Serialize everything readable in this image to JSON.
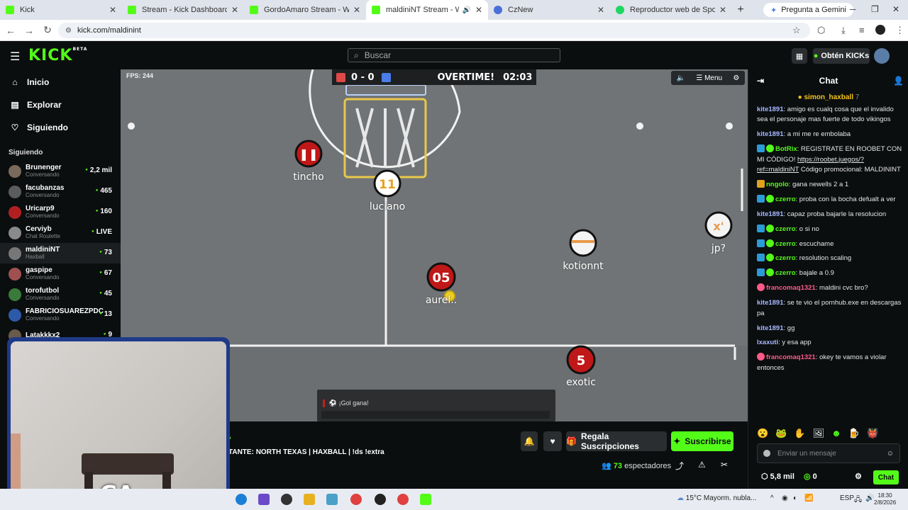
{
  "browser": {
    "tabs": [
      {
        "title": "Kick",
        "color": "#53fc18"
      },
      {
        "title": "Stream - Kick Dashboard",
        "color": "#53fc18"
      },
      {
        "title": "GordoAmaro Stream - Watch L",
        "color": "#53fc18"
      },
      {
        "title": "maldiniNT Stream - Watch",
        "color": "#53fc18",
        "active": true
      },
      {
        "title": "CzNew",
        "color": "#4a6fd8"
      },
      {
        "title": "Reproductor web de Spotify: m",
        "color": "#1ed760"
      }
    ],
    "gemini_label": "Pregunta a Gemini",
    "url": "kick.com/maldinint"
  },
  "header": {
    "logo": "KICK",
    "logo_badge": "BETA",
    "search_placeholder": "Buscar",
    "kicks_button": "Obtén KICKs"
  },
  "sidebar": {
    "nav": [
      {
        "label": "Inicio",
        "icon": "home-icon"
      },
      {
        "label": "Explorar",
        "icon": "compass-icon"
      },
      {
        "label": "Siguiendo",
        "icon": "heart-icon"
      }
    ],
    "following_title": "Siguiendo",
    "following": [
      {
        "name": "Brunenger",
        "category": "Conversando",
        "viewers": "2,2 mil",
        "color": "#7a6a5c"
      },
      {
        "name": "facubanzas",
        "category": "Conversando",
        "viewers": "465",
        "color": "#5c5c5c"
      },
      {
        "name": "Uricarp9",
        "category": "Conversando",
        "viewers": "160",
        "color": "#b02020"
      },
      {
        "name": "Cerviyb",
        "category": "Chat Roulette",
        "viewers": "LIVE",
        "color": "#8a8a8a"
      },
      {
        "name": "maldiniNT",
        "category": "Haxball",
        "viewers": "73",
        "color": "#777777",
        "active": true
      },
      {
        "name": "gaspipe",
        "category": "Conversando",
        "viewers": "67",
        "color": "#a05050"
      },
      {
        "name": "torofutbol",
        "category": "Conversando",
        "viewers": "45",
        "color": "#3a7a3a"
      },
      {
        "name": "FABRICIOSUAREZPDC",
        "category": "Conversando",
        "viewers": "13",
        "color": "#2d5aa8"
      },
      {
        "name": "Latakkkx2",
        "category": "",
        "viewers": "9",
        "color": "#6a5a4a"
      }
    ]
  },
  "video": {
    "fps": "FPS: 244",
    "score": "0 - 0",
    "status": "OVERTIME!",
    "clock": "02:03",
    "menu_label": "Menu",
    "players": [
      {
        "name": "tincho",
        "number": ""
      },
      {
        "name": "luciano",
        "number": "11"
      },
      {
        "name": "kotionnt",
        "number": ""
      },
      {
        "name": "jp?",
        "number": ""
      },
      {
        "name": "aurel..",
        "number": "05"
      },
      {
        "name": "exotic",
        "number": "5"
      }
    ],
    "notice": "¡Gol gana!",
    "cam_label": "GA"
  },
  "below": {
    "title": "TANTE: NORTH TEXAS | HAXBALL | !ds !extra",
    "gift_button": "Regala Suscripciones",
    "subscribe_button": "Suscribirse",
    "viewers_count": "73",
    "viewers_label": "espectadores"
  },
  "chat": {
    "title": "Chat",
    "pinned_user": "simon_haxball",
    "pinned_count": "7",
    "messages": [
      {
        "user": "kite1891",
        "color": "#a8b8ff",
        "text": "amigo es cualq cosa que el invalido sea el personaje mas fuerte de todo vikingos"
      },
      {
        "user": "kite1891",
        "color": "#a8b8ff",
        "text": "a mi me re embolaba"
      },
      {
        "user": "BotRix",
        "color": "#53fc18",
        "badges": [
          "#2d9ad8",
          "#53fc18"
        ],
        "text": "REGISTRATE EN ROOBET CON MI CÓDIGO!",
        "link": "https://roobet.juegos/?ref=maldiniNT",
        "text2": "Código promocional: MALDININT"
      },
      {
        "user": "nngolo",
        "color": "#53fc18",
        "badges": [
          "#e0a020"
        ],
        "text": "gana newells 2 a 1"
      },
      {
        "user": "czerro",
        "color": "#53fc18",
        "badges": [
          "#2d9ad8",
          "#53fc18"
        ],
        "text": "proba con la bocha defualt a ver"
      },
      {
        "user": "kite1891",
        "color": "#a8b8ff",
        "text": "capaz proba bajarle la resolucion"
      },
      {
        "user": "czerro",
        "color": "#53fc18",
        "badges": [
          "#2d9ad8",
          "#53fc18"
        ],
        "text": "o si no"
      },
      {
        "user": "czerro",
        "color": "#53fc18",
        "badges": [
          "#2d9ad8",
          "#53fc18"
        ],
        "text": "escuchame"
      },
      {
        "user": "czerro",
        "color": "#53fc18",
        "badges": [
          "#2d9ad8",
          "#53fc18"
        ],
        "text": "resolution scaling"
      },
      {
        "user": "czerro",
        "color": "#53fc18",
        "badges": [
          "#2d9ad8",
          "#53fc18"
        ],
        "text": "bajale a 0.9"
      },
      {
        "user": "francomaq1321",
        "color": "#ff5a8a",
        "badges": [
          "#ff5a8a"
        ],
        "text": "maldini cvc bro?"
      },
      {
        "user": "kite1891",
        "color": "#a8b8ff",
        "text": "se te vio el pornhub.exe en descargas pa"
      },
      {
        "user": "kite1891",
        "color": "#a8b8ff",
        "text": "gg"
      },
      {
        "user": "lxaxuti",
        "color": "#a8b8ff",
        "text": "y esa app"
      },
      {
        "user": "francomaq1321",
        "color": "#ff5a8a",
        "badges": [
          "#ff5a8a"
        ],
        "text": "okey te vamos a violar entonces"
      }
    ],
    "input_placeholder": "Enviar un mensaje",
    "kicks_total": "5,8 mil",
    "points": "0",
    "send_label": "Chat"
  },
  "taskbar": {
    "weather": "15°C  Mayorm. nubla...",
    "lang": "ESP",
    "time": "18:30",
    "date": "2/8/2026"
  }
}
